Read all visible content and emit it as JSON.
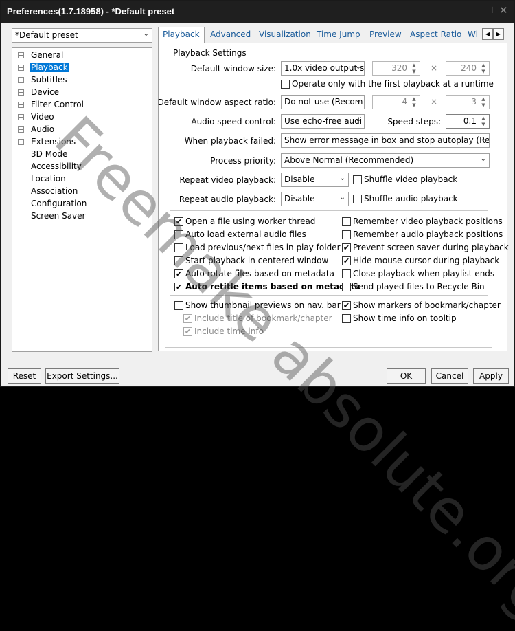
{
  "window": {
    "title": "Preferences(1.7.18958) - *Default preset",
    "pin_glyph": "⊣",
    "close_glyph": "✕"
  },
  "preset": {
    "selected": "*Default preset"
  },
  "tree": {
    "items": [
      {
        "label": "General",
        "expandable": true
      },
      {
        "label": "Playback",
        "expandable": true,
        "selected": true
      },
      {
        "label": "Subtitles",
        "expandable": true
      },
      {
        "label": "Device",
        "expandable": true
      },
      {
        "label": "Filter Control",
        "expandable": true
      },
      {
        "label": "Video",
        "expandable": true
      },
      {
        "label": "Audio",
        "expandable": true
      },
      {
        "label": "Extensions",
        "expandable": true
      },
      {
        "label": "3D Mode",
        "expandable": false
      },
      {
        "label": "Accessibility",
        "expandable": false
      },
      {
        "label": "Location",
        "expandable": false
      },
      {
        "label": "Association",
        "expandable": false
      },
      {
        "label": "Configuration",
        "expandable": false
      },
      {
        "label": "Screen Saver",
        "expandable": false
      }
    ]
  },
  "tabs": [
    "Playback",
    "Advanced",
    "Visualization",
    "Time Jump",
    "Preview",
    "Aspect Ratio",
    "Wi"
  ],
  "tab_scroll": {
    "left": "◀",
    "right": "▶"
  },
  "group": {
    "title": "Playback Settings",
    "default_window_size": {
      "label": "Default window size:",
      "value": "1.0x video output s",
      "width": "320",
      "height": "240"
    },
    "first_playback_only": "Operate only with the first playback at a runtime",
    "aspect_ratio": {
      "label": "Default window aspect ratio:",
      "value": "Do not use (Recom",
      "x": "4",
      "y": "3"
    },
    "times_sign": "×",
    "audio_speed": {
      "label": "Audio speed control:",
      "value": "Use echo-free audi",
      "steps_label": "Speed steps:",
      "steps_value": "0.1"
    },
    "playback_failed": {
      "label": "When playback failed:",
      "value": "Show error message in box and stop autoplay (Recom"
    },
    "process_priority": {
      "label": "Process priority:",
      "value": "Above Normal (Recommended)"
    },
    "repeat_video": {
      "label": "Repeat video playback:",
      "value": "Disable",
      "shuffle": "Shuffle video playback"
    },
    "repeat_audio": {
      "label": "Repeat audio playback:",
      "value": "Disable",
      "shuffle": "Shuffle audio playback"
    }
  },
  "options_left": [
    {
      "label": "Open a file using worker thread",
      "checked": true
    },
    {
      "label": "Auto load external audio files",
      "checked": false
    },
    {
      "label": "Load previous/next files in play folder",
      "checked": false
    },
    {
      "label": "Start playback in centered window",
      "checked": false
    },
    {
      "label": "Auto rotate files based on metadata",
      "checked": true
    },
    {
      "label": "Auto retitle items based on metadata",
      "checked": true,
      "bold": true
    }
  ],
  "options_right": [
    {
      "label": "Remember video playback positions",
      "checked": false
    },
    {
      "label": "Remember audio playback positions",
      "checked": false
    },
    {
      "label": "Prevent screen saver during playback",
      "checked": true
    },
    {
      "label": "Hide mouse cursor during playback",
      "checked": true
    },
    {
      "label": "Close playback when playlist ends",
      "checked": false
    },
    {
      "label": "Send played files to Recycle Bin",
      "checked": false
    }
  ],
  "thumbnails": {
    "show": {
      "label": "Show thumbnail previews on nav. bar",
      "checked": false
    },
    "include_title": {
      "label": "Include title of bookmark/chapter",
      "checked": true,
      "disabled": true
    },
    "include_time": {
      "label": "Include time info",
      "checked": true,
      "disabled": true
    },
    "show_markers": {
      "label": "Show markers of bookmark/chapter",
      "checked": true
    },
    "show_time_tooltip": {
      "label": "Show time info on tooltip",
      "checked": false
    }
  },
  "check_glyph": "✔",
  "footer": {
    "reset": "Reset",
    "export": "Export Settings...",
    "ok": "OK",
    "cancel": "Cancel",
    "apply": "Apply"
  },
  "watermark": "Freemake absolute.org"
}
